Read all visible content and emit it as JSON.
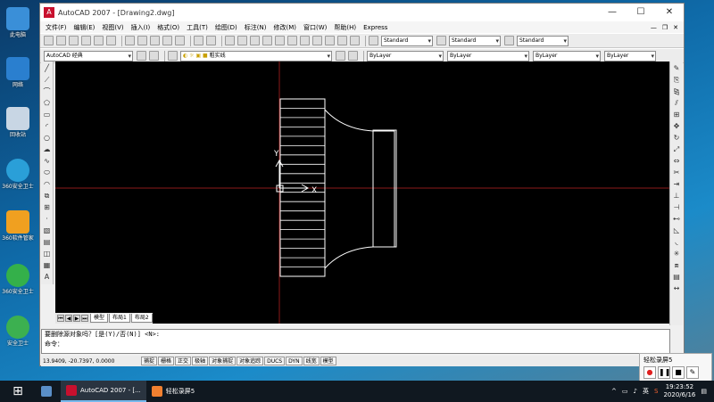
{
  "desktop": {
    "icons": [
      {
        "label": "此电脑",
        "color": "#3a8fd8"
      },
      {
        "label": "网络",
        "color": "#2a7fcf"
      },
      {
        "label": "回收站",
        "color": "#c8d6e4"
      },
      {
        "label": "360安全卫士",
        "color": "#2a9fd8"
      },
      {
        "label": "360软件管家",
        "color": "#f0a020"
      },
      {
        "label": "360安全卫士",
        "color": "#34b04a"
      },
      {
        "label": "安全卫士",
        "color": "#3cb050"
      }
    ]
  },
  "window": {
    "title": "AutoCAD 2007 - [Drawing2.dwg]",
    "minimize": "—",
    "maximize": "☐",
    "close": "✕"
  },
  "menu": [
    "文件(F)",
    "编辑(E)",
    "视图(V)",
    "插入(I)",
    "格式(O)",
    "工具(T)",
    "绘图(D)",
    "标注(N)",
    "修改(M)",
    "窗口(W)",
    "帮助(H)",
    "Express"
  ],
  "toolbar1": {
    "text_style": "Standard",
    "dim_style": "Standard",
    "table_style": "Standard"
  },
  "toolbar2": {
    "workspace": "AutoCAD 经典",
    "layer": "粗实线",
    "color": "ByLayer",
    "linetype": "ByLayer",
    "lineweight": "ByLayer",
    "plotstyle": "ByLayer"
  },
  "drawing": {
    "ucs_x": "X",
    "ucs_y": "Y",
    "hatch_lines": 18,
    "axis_color": "#8b1a1a",
    "line_color": "#ffffff"
  },
  "tabs": {
    "model": "模型",
    "layout1": "布局1",
    "layout2": "布局2"
  },
  "command": {
    "line1": "要删除源对象吗？[是(Y)/否(N)] <N>:",
    "line2": "命令："
  },
  "status": {
    "coords": "13.9409, -20.7397, 0.0000",
    "buttons": [
      "捕捉",
      "栅格",
      "正交",
      "极轴",
      "对象捕捉",
      "对象追踪",
      "DUCS",
      "DYN",
      "线宽",
      "模型"
    ]
  },
  "recorder": {
    "title": "轻松录屏5"
  },
  "taskbar": {
    "app1": "AutoCAD 2007 - [...",
    "app2": "轻松录屏5",
    "ime": "英",
    "time": "19:23:52",
    "date": "2020/6/16"
  }
}
